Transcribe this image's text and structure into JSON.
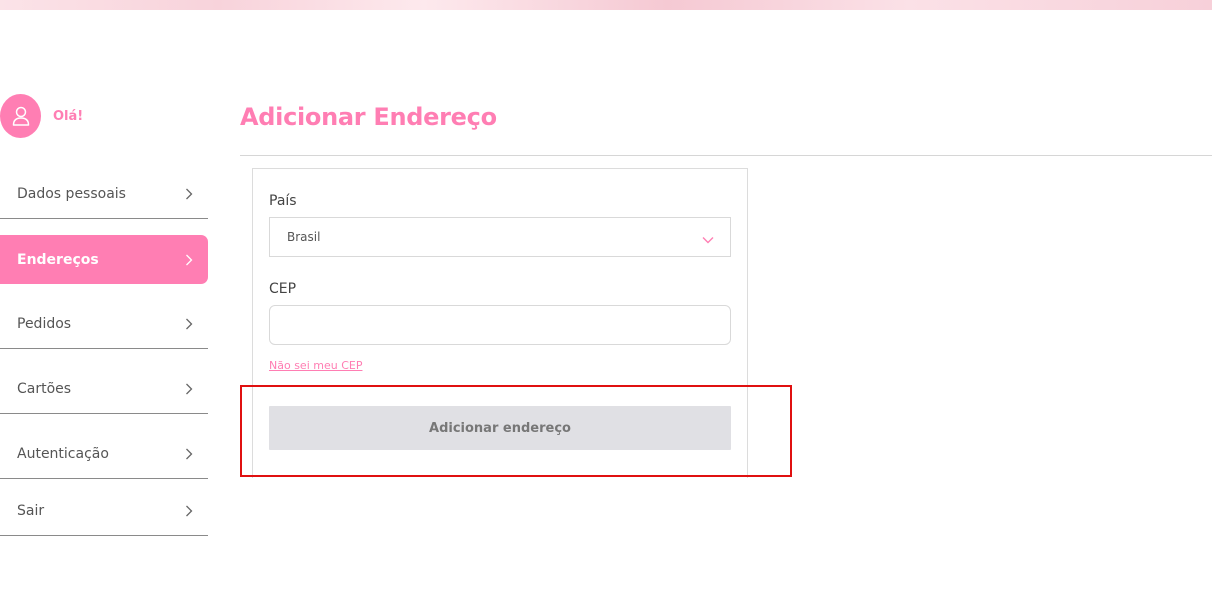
{
  "user": {
    "greeting": "Olá!"
  },
  "sidebar": {
    "items": [
      {
        "label": "Dados pessoais",
        "active": false
      },
      {
        "label": "Endereços",
        "active": true
      },
      {
        "label": "Pedidos",
        "active": false
      },
      {
        "label": "Cartões",
        "active": false
      },
      {
        "label": "Autenticação",
        "active": false
      },
      {
        "label": "Sair",
        "active": false
      }
    ]
  },
  "main": {
    "title": "Adicionar Endereço",
    "form": {
      "country_label": "País",
      "country_value": "Brasil",
      "cep_label": "CEP",
      "cep_value": "",
      "cep_placeholder": "",
      "cep_help_link": "Não sei meu CEP",
      "submit_label": "Adicionar endereço"
    }
  },
  "colors": {
    "accent": "#ff7eb3",
    "disabled_button": "#e0e0e4",
    "highlight": "#e01010"
  },
  "icons": {
    "avatar": "user-icon",
    "sidebar_chevron": "chevron-right-icon",
    "select_chevron": "chevron-down-icon"
  }
}
